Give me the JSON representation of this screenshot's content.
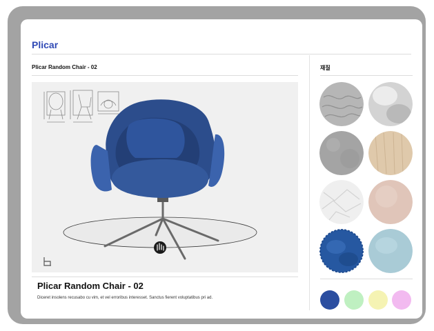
{
  "app": {
    "brand": "Plicar"
  },
  "header": {
    "product_title": "Plicar Random Chair - 02"
  },
  "viewer": {
    "rotate_icon": "hand-rotate-icon",
    "chair_icon": "chair-icon",
    "blueprint_icon": "blueprint-views-icon"
  },
  "caption": {
    "title": "Plicar Random Chair - 02",
    "description": "Diceret insolens recusabo cu vim, et vel erroribus interesset. Sanctus fierent voluptatibus pri ad."
  },
  "materials": {
    "label": "재질",
    "items": [
      {
        "name": "gray-leather",
        "color": "#b6b6b6"
      },
      {
        "name": "silver-metal",
        "color": "#d3d3d3"
      },
      {
        "name": "gray-fabric",
        "color": "#a4a4a4"
      },
      {
        "name": "light-wood",
        "color": "#dfc9ab"
      },
      {
        "name": "white-leather",
        "color": "#efefef"
      },
      {
        "name": "pink-leather",
        "color": "#e0c5b9"
      },
      {
        "name": "blue-velvet",
        "color": "#2658a1"
      },
      {
        "name": "light-blue-fabric",
        "color": "#a9cbd6"
      }
    ]
  },
  "colors": {
    "items": [
      {
        "name": "navy",
        "hex": "#2b4ea0"
      },
      {
        "name": "mint-green",
        "hex": "#bff0c1"
      },
      {
        "name": "pale-yellow",
        "hex": "#f5f3b3"
      },
      {
        "name": "pink",
        "hex": "#f2baf0"
      }
    ]
  }
}
